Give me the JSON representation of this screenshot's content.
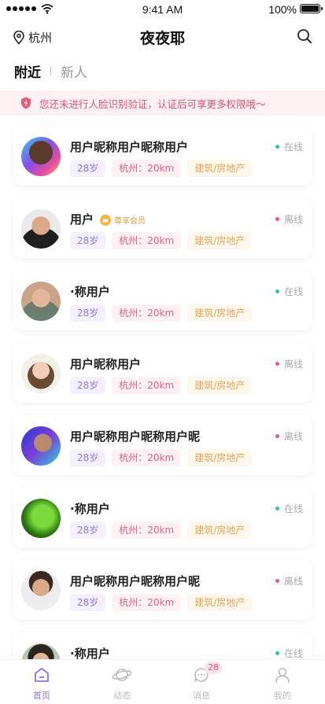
{
  "status_bar": {
    "time": "9:41 AM",
    "battery": "100%"
  },
  "header": {
    "location": "杭州",
    "title": "夜夜耶"
  },
  "tabs": {
    "active": "附近",
    "other": "新人"
  },
  "notice": {
    "text": "您还未进行人脸识别验证，认证后可享更多权限哦～"
  },
  "users": [
    {
      "name": "用户昵称用户昵称用户",
      "status": "在线",
      "status_color": "#2ec5a5",
      "age": "28岁",
      "city": "杭州：20km",
      "job": "建筑/房地产",
      "vip": ""
    },
    {
      "name": "用户",
      "status": "离线",
      "status_color": "#e85a77",
      "age": "28岁",
      "city": "杭州：20km",
      "job": "建筑/房地产",
      "vip": "尊享会员"
    },
    {
      "name": "·称用户",
      "status": "在线",
      "status_color": "#2ec5a5",
      "age": "28岁",
      "city": "杭州：20km",
      "job": "建筑/房地产",
      "vip": ""
    },
    {
      "name": "用户昵称用户",
      "status": "离线",
      "status_color": "#e85a77",
      "age": "28岁",
      "city": "杭州：20km",
      "job": "建筑/房地产",
      "vip": ""
    },
    {
      "name": "用户昵称用户昵称用户昵",
      "status": "离线",
      "status_color": "#e85a77",
      "age": "28岁",
      "city": "杭州：20km",
      "job": "建筑/房地产",
      "vip": ""
    },
    {
      "name": "·称用户",
      "status": "在线",
      "status_color": "#2ec5a5",
      "age": "28岁",
      "city": "杭州：20km",
      "job": "建筑/房地产",
      "vip": ""
    },
    {
      "name": "用户昵称用户昵称用户昵",
      "status": "离线",
      "status_color": "#e85a77",
      "age": "28岁",
      "city": "杭州：20km",
      "job": "建筑/房地产",
      "vip": ""
    },
    {
      "name": "·称用户",
      "status": "在线",
      "status_color": "#2ec5a5",
      "age": "",
      "city": "",
      "job": "",
      "vip": ""
    }
  ],
  "tabbar": {
    "items": [
      {
        "label": "首页",
        "icon": "home-icon"
      },
      {
        "label": "动态",
        "icon": "planet-icon"
      },
      {
        "label": "消息",
        "icon": "chat-icon",
        "badge": "28"
      },
      {
        "label": "我的",
        "icon": "profile-icon"
      }
    ]
  },
  "colors": {
    "accent": "#8d6ef2",
    "online": "#2ec5a5",
    "offline": "#e85a77",
    "notice": "#e05572"
  }
}
